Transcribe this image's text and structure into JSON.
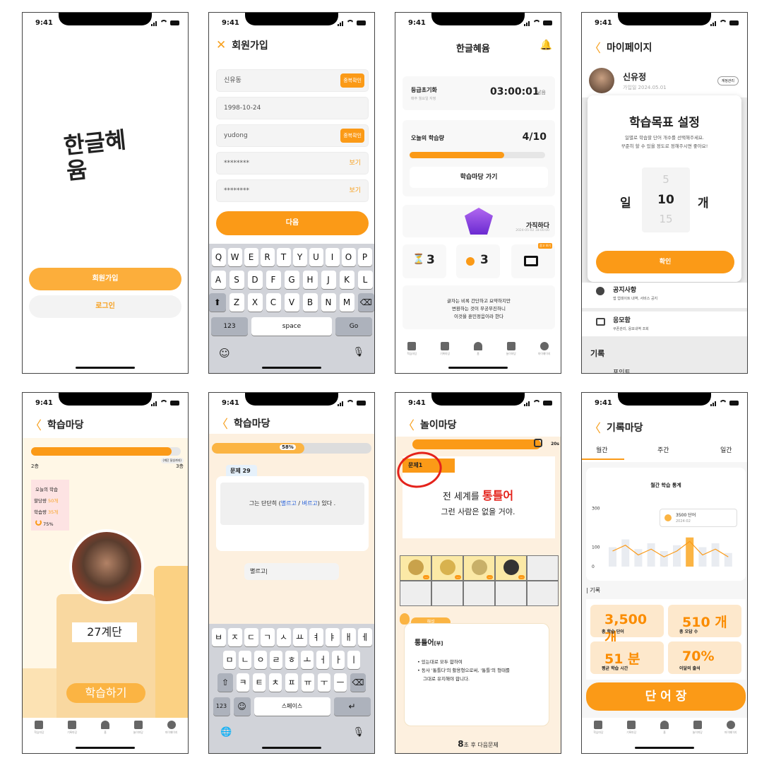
{
  "status_time": "9:41",
  "s1": {
    "logo": "한글혜윰",
    "signup": "회원가입",
    "login": "로그인"
  },
  "s2": {
    "title": "회원가입",
    "name": "신유동",
    "birth": "1998-10-24",
    "id": "yudong",
    "pw1": "********",
    "pw2": "********",
    "dup1": "중복확인",
    "dup2": "중복확인",
    "show1": "보기",
    "show2": "보기",
    "next": "다음",
    "keys_r1": [
      "Q",
      "W",
      "E",
      "R",
      "T",
      "Y",
      "U",
      "I",
      "O",
      "P"
    ],
    "keys_r2": [
      "A",
      "S",
      "D",
      "F",
      "G",
      "H",
      "J",
      "K",
      "L"
    ],
    "keys_r3": [
      "Z",
      "X",
      "C",
      "V",
      "B",
      "N",
      "M"
    ],
    "k123": "123",
    "space": "space",
    "go": "Go"
  },
  "s3": {
    "brand": "한글혜윰",
    "reset_label": "등급초기화",
    "reset_sub": "매주 월요일 자정",
    "timer": "03:00:01",
    "timer_suffix": "남음",
    "today_label": "오늘의 학습량",
    "today_value": "4/10",
    "progress": 0.7,
    "go_btn": "학습마당 가기",
    "rank_name": "가직하다",
    "rank_date": "2024-05-02 18:00:00",
    "trophy_count": "3",
    "coin_count": "3",
    "ad_badge": "광고 보기",
    "quote_l1": "글자는 비록 간단하고 요약하지만",
    "quote_l2": "변환하는 것이 무궁무진하니",
    "quote_l3": "이것을 훈민정음이라 한다",
    "nav": [
      "학습마당",
      "기록마당",
      "홈",
      "놀이마당",
      "마이페이지"
    ]
  },
  "s4": {
    "title": "마이페이지",
    "user": "신유정",
    "joined": "가입일 2024.05.01",
    "manage": "계정관리",
    "modal_title": "학습목표 설정",
    "modal_d1": "일별로 학습할 단어 개수를 선택해주세요.",
    "modal_d2": "꾸준히 할 수 있을 정도로 정해주시면 좋아요!",
    "unit_l": "일",
    "unit_r": "개",
    "p_prev": "5",
    "p_cur": "10",
    "p_next": "15",
    "confirm": "확인",
    "notice": "공지사항",
    "notice_sub": "앱 업데이트 내역, 서비스 공지",
    "support": "응모함",
    "support_sub": "쿠폰관리, 응모내역 조회",
    "section": "기록",
    "point": "포인트"
  },
  "s5": {
    "title": "학습마당",
    "floor_l": "2층",
    "floor_r": "3층",
    "bubble": "(계단 달성까지)",
    "today": "오늘의 학습",
    "goal_l": "할당량",
    "goal_v": "50개",
    "learned_l": "학습량",
    "learned_v": "35개",
    "pct": "75%",
    "progress": 0.94,
    "stage": "27계단",
    "start": "학습하기",
    "nav": [
      "학습마당",
      "기록마당",
      "홈",
      "놀이마당",
      "마이페이지"
    ]
  },
  "s6": {
    "title": "학습마당",
    "pct": "58%",
    "progress": 0.58,
    "qnum": "문제 29",
    "q_pre": "그는 단단히 (",
    "opt1": "별르고",
    "sep": "/",
    "opt2": "벼르고",
    "q_post": ") 있다 .",
    "answer": "별르고|",
    "r1": [
      "ㅂ",
      "ㅈ",
      "ㄷ",
      "ㄱ",
      "ㅅ",
      "ㅛ",
      "ㅕ",
      "ㅑ",
      "ㅐ",
      "ㅔ"
    ],
    "r2": [
      "ㅁ",
      "ㄴ",
      "ㅇ",
      "ㄹ",
      "ㅎ",
      "ㅗ",
      "ㅓ",
      "ㅏ",
      "ㅣ"
    ],
    "r3": [
      "ㅋ",
      "ㅌ",
      "ㅊ",
      "ㅍ",
      "ㅠ",
      "ㅜ",
      "ㅡ"
    ],
    "k123": "123",
    "space": "스페이스"
  },
  "s7": {
    "title": "놀이마당",
    "timer_sec": "20s",
    "qlabel": "문제1",
    "l1_pre": "전 세계를",
    "l1_word": "통틀어",
    "l2": "그런 사람은 없을 거야.",
    "hint_tab": "해설",
    "word": "통틀어",
    "pos": "[부]",
    "b1": "있는대로 모두 합하여",
    "b2": "동사 '통틀다'의 활용형으로써, '통틀'의 형태를",
    "b3": "그대로 유지해야 합니다.",
    "next_pre": "8",
    "next_post": "초 후 다음문제",
    "dots": "..."
  },
  "s8": {
    "title": "기록마당",
    "tabs": [
      "월간",
      "주간",
      "일간"
    ],
    "chart_title": "월간 학습 통계",
    "tip_value": "3500 단어",
    "tip_date": "2024-02",
    "record": "| 기록",
    "st1_v": "3,500 개",
    "st1_l": "총 학습 단어",
    "st2_v": "510 개",
    "st2_l": "총 오답 수",
    "st3_v": "51 분",
    "st3_l": "평균 학습 시간",
    "st4_v": "70%",
    "st4_l": "이달의 출석",
    "vocab": "단 어 장",
    "nav": [
      "학습마당",
      "기록마당",
      "홈",
      "놀이마당",
      "마이페이지"
    ]
  },
  "chart_data": {
    "type": "bar",
    "title": "월간 학습 통계",
    "yticks": [
      0,
      100,
      300
    ],
    "ylim": [
      0,
      320
    ],
    "values": [
      100,
      140,
      90,
      120,
      80,
      110,
      150,
      100,
      120,
      70
    ],
    "line": [
      80,
      110,
      60,
      90,
      50,
      80,
      130,
      60,
      90,
      50
    ],
    "highlight_index": 6
  }
}
